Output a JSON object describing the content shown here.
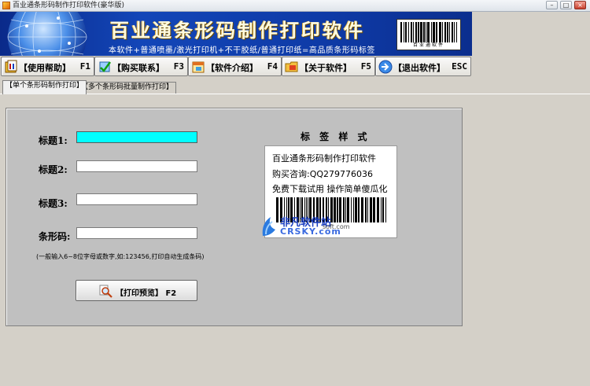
{
  "window": {
    "title": "百业通条形码制作打印软件(豪华版)",
    "controls": [
      "–",
      "□",
      "×"
    ]
  },
  "banner": {
    "title": "百业通条形码制作打印软件",
    "subtitle": "本软件+普通喷墨/激光打印机+不干胶纸/普通打印纸=高品质条形码标签",
    "barcode_label": "百业通软件"
  },
  "toolbar": {
    "buttons": [
      {
        "icon": "help-book-icon",
        "label": "【使用帮助】",
        "key": "F1"
      },
      {
        "icon": "cart-buy-icon",
        "label": "【购买联系】",
        "key": "F3"
      },
      {
        "icon": "calendar-intro-icon",
        "label": "【软件介绍】",
        "key": "F4"
      },
      {
        "icon": "about-folder-icon",
        "label": "【关于软件】",
        "key": "F5"
      },
      {
        "icon": "exit-arrow-icon",
        "label": "【退出软件】",
        "key": "ESC"
      }
    ]
  },
  "tabs": [
    {
      "label": "【单个条形码制作打印】",
      "selected": true
    },
    {
      "label": "【多个条形码批量制作打印】",
      "selected": false
    }
  ],
  "form": {
    "fields": [
      {
        "label": "标题1:",
        "value": ""
      },
      {
        "label": "标题2:",
        "value": ""
      },
      {
        "label": "标题3:",
        "value": ""
      },
      {
        "label": "条形码:",
        "value": ""
      }
    ],
    "hint": "(一般输入6~8位字母或数字,如:123456,打印自动生成条码)",
    "preview_button": {
      "label": "【打印预览】 F2",
      "icon": "magnifier-icon"
    }
  },
  "label_preview": {
    "heading": "标 签 样 式",
    "lines": [
      "百业通条形码制作打印软件",
      "购买咨询:QQ279776036",
      "免费下载试用 操作简单傻瓜化"
    ]
  },
  "watermark": {
    "name": "非凡软件站",
    "brand": "CRSKY.com",
    "url_fragment": "soft.com"
  },
  "colors": {
    "active_input": "#00ffff",
    "banner_blue": "#1346b8",
    "window_bg": "#d4d0c8"
  }
}
